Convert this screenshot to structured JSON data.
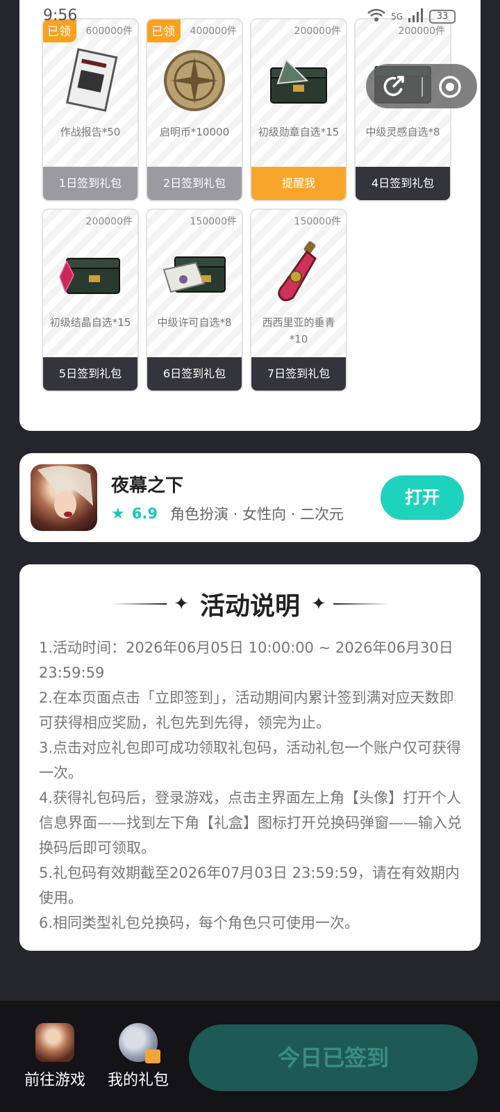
{
  "status_bar": {
    "time": "9:56",
    "network": "5G",
    "battery": "33"
  },
  "gifts": [
    {
      "stock": "600000件",
      "name": "作战报告*50",
      "day": "1日签到礼包",
      "claimed": "已领"
    },
    {
      "stock": "400000件",
      "name": "启明币*10000",
      "day": "2日签到礼包",
      "claimed": "已领"
    },
    {
      "stock": "200000件",
      "name": "初级勋章自选*15",
      "day": "提醒我"
    },
    {
      "stock": "200000件",
      "name": "中级灵感自选*8",
      "day": "4日签到礼包"
    },
    {
      "stock": "200000件",
      "name": "初级结晶自选*15",
      "day": "5日签到礼包"
    },
    {
      "stock": "150000件",
      "name": "中级许可自选*8",
      "day": "6日签到礼包"
    },
    {
      "stock": "150000件",
      "name": "西西里亚的垂青*10",
      "day": "7日签到礼包"
    }
  ],
  "app": {
    "name": "夜幕之下",
    "score": "6.9",
    "tags": "角色扮演 · 女性向 · 二次元",
    "open_label": "打开"
  },
  "rules": {
    "title": "活动说明",
    "items": [
      "1.活动时间：2026年06月05日 10:00:00 ~ 2026年06月30日 23:59:59",
      "2.在本页面点击「立即签到」，活动期间内累计签到满对应天数即可获得相应奖励，礼包先到先得，领完为止。",
      "3.点击对应礼包即可成功领取礼包码，活动礼包一个账户仅可获得一次。",
      "4.获得礼包码后，登录游戏，点击主界面左上角【头像】打开个人信息界面——找到左下角【礼盒】图标打开兑换码弹窗——输入兑换码后即可领取。",
      "5.礼包码有效期截至2026年07月03日 23:59:59，请在有效期内使用。",
      "6.相同类型礼包兑换码，每个角色只可使用一次。"
    ]
  },
  "bottom": {
    "go_game": "前往游戏",
    "my_gifts": "我的礼包",
    "signed": "今日已签到"
  },
  "colors": {
    "accent": "#1fd2bd",
    "orange": "#f8a62b",
    "dark": "#34343c"
  }
}
